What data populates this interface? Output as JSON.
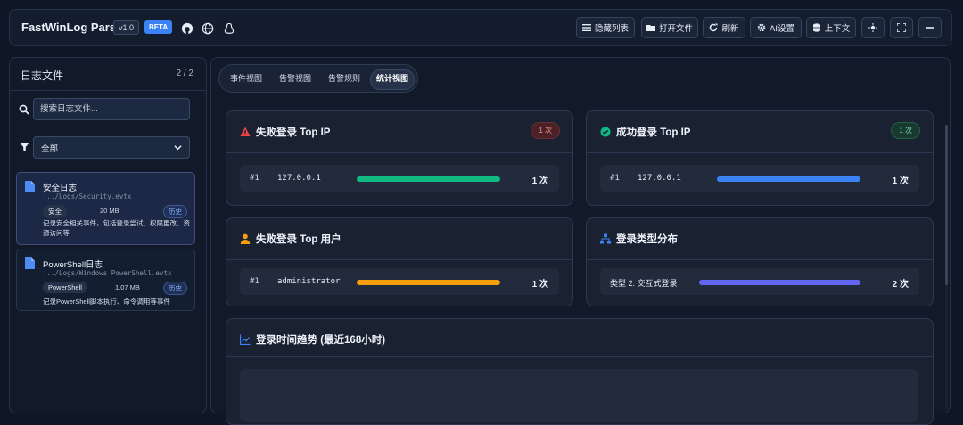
{
  "header": {
    "title": "FastWinLog Parse",
    "version": "v1.0",
    "beta": "BETA",
    "buttons": {
      "hide_list": "隐藏列表",
      "open_file": "打开文件",
      "refresh": "刷新",
      "ai_settings": "AI设置",
      "context": "上下文"
    }
  },
  "sidebar": {
    "title": "日志文件",
    "count": "2 / 2",
    "search_placeholder": "搜索日志文件...",
    "filter_value": "全部",
    "files": [
      {
        "name": "安全日志",
        "path": ".../Logs/Security.evtx",
        "tag": "安全",
        "size": "20 MB",
        "history": "历史",
        "desc": "记录安全相关事件，包括登录尝试、权限更改、资源访问等"
      },
      {
        "name": "PowerShell日志",
        "path": ".../Logs/Windows PowerShell.evtx",
        "tag": "PowerShell",
        "size": "1.07 MB",
        "history": "历史",
        "desc": "记录PowerShell脚本执行、命令调用等事件"
      }
    ]
  },
  "main": {
    "tabs": [
      "事件视图",
      "告警视图",
      "告警规则",
      "统计视图"
    ],
    "active_tab": "统计视图",
    "cards": {
      "failed_ip": {
        "title": "失败登录 Top IP",
        "badge": "1 次",
        "color": "#10b981",
        "rows": [
          {
            "rank": "#1",
            "label": "127.0.0.1",
            "value": "1 次",
            "fill": 1.0
          }
        ]
      },
      "success_ip": {
        "title": "成功登录 Top IP",
        "badge": "1 次",
        "color": "#3b82f6",
        "rows": [
          {
            "rank": "#1",
            "label": "127.0.0.1",
            "value": "1 次",
            "fill": 1.0
          }
        ]
      },
      "failed_user": {
        "title": "失败登录 Top 用户",
        "color": "#f59e0b",
        "rows": [
          {
            "rank": "#1",
            "label": "administrator",
            "value": "1 次",
            "fill": 1.0
          }
        ]
      },
      "logon_type": {
        "title": "登录类型分布",
        "color": "#6366f1",
        "rows": [
          {
            "label": "类型 2: 交互式登录",
            "value": "2 次",
            "fill": 1.0
          }
        ]
      },
      "trend": {
        "title": "登录时间趋势 (最近168小时)"
      }
    }
  },
  "colors": {
    "accent_blue": "#3b82f6",
    "danger_red": "#ef4444",
    "success_green": "#10b981",
    "warning_amber": "#f59e0b",
    "indigo": "#6366f1"
  }
}
